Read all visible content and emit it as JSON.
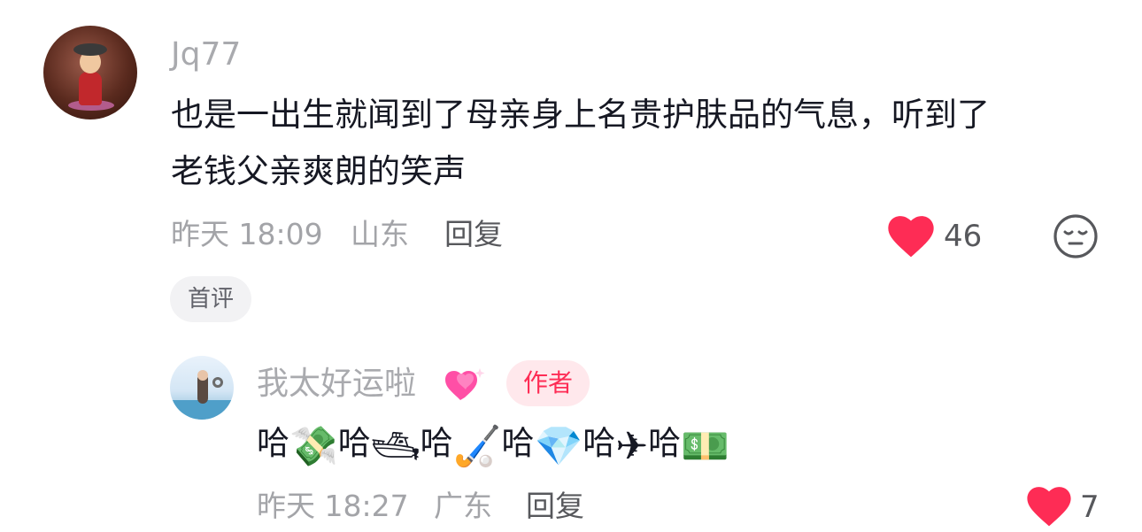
{
  "comment": {
    "username": "Jq77",
    "text_line1": "也是一出生就闻到了母亲身上名贵护肤品的气息，听到了",
    "text_line2": "老钱父亲爽朗的笑声",
    "time": "昨天 18:09",
    "location": "山东",
    "reply_label": "回复",
    "like_count": "46",
    "first_badge": "首评"
  },
  "reply": {
    "username": "我太好运啦",
    "author_badge": "作者",
    "content_parts": [
      "哈",
      "💸",
      "哈",
      "🛥",
      "哈",
      "🏑",
      "哈",
      "💎",
      "哈",
      "✈",
      "哈",
      "💵"
    ],
    "time": "昨天 18:27",
    "location": "广东",
    "reply_label": "回复",
    "like_count": "7"
  },
  "icons": {
    "like": "heart-icon",
    "dislike": "dislike-face-icon"
  },
  "colors": {
    "like_red": "#fe2c55",
    "username_gray": "#a9aaae",
    "meta_gray": "#a3a4a8",
    "text_dark": "#161823"
  }
}
